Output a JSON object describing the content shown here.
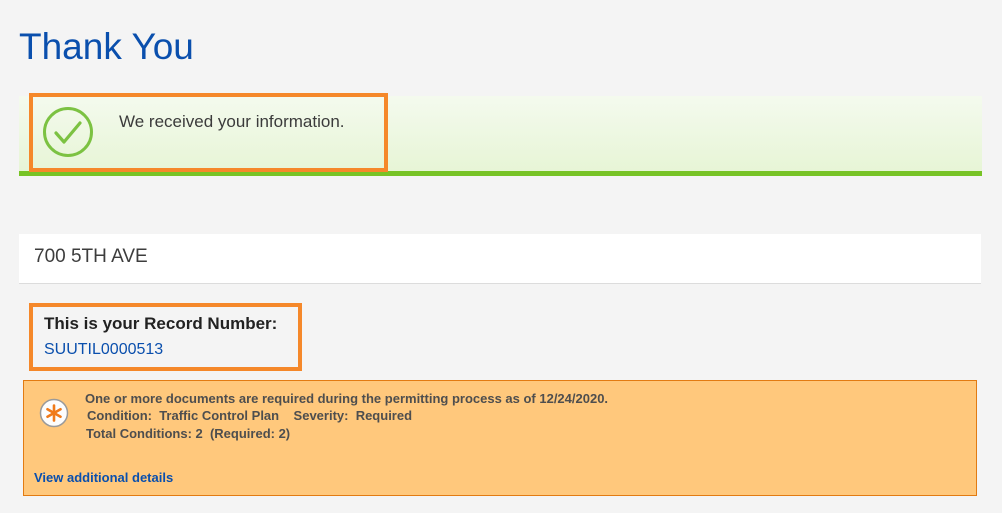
{
  "page": {
    "title": "Thank You"
  },
  "success_banner": {
    "message": "We received your information.",
    "icon": "check-circle-icon",
    "accent_color": "#77c325"
  },
  "address": {
    "text": "700 5TH AVE"
  },
  "record": {
    "label": "This is your Record Number:",
    "number": "SUUTIL0000513"
  },
  "notice": {
    "icon": "asterisk-icon",
    "line1": "One or more documents are required during the permitting process as of 12/24/2020.",
    "line2": "Condition:  Traffic Control Plan    Severity:  Required",
    "line3": "Total Conditions: 2  (Required: 2)",
    "link_label": "View additional details",
    "background_color": "#ffc87c"
  },
  "highlight_color": "#f5882a",
  "link_color": "#0a4fad"
}
